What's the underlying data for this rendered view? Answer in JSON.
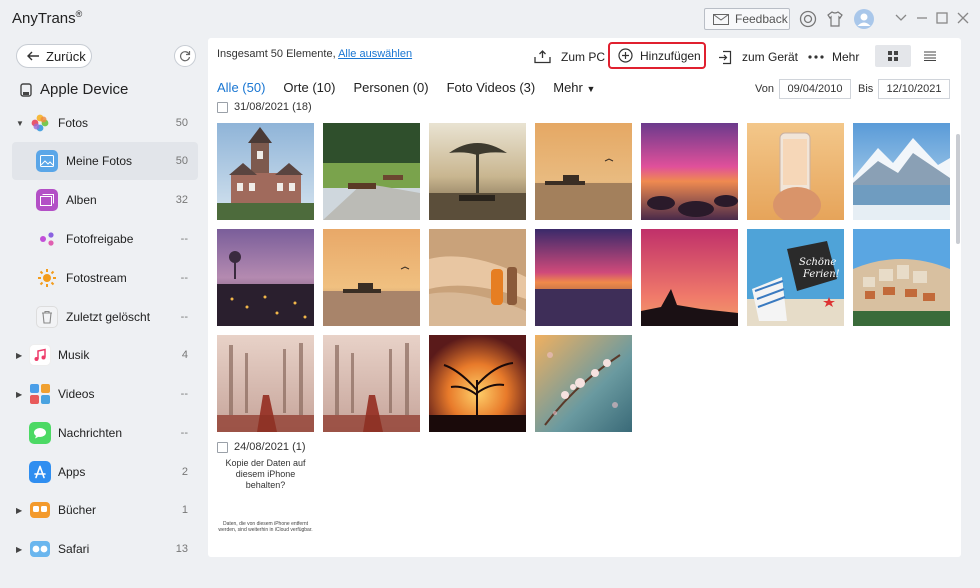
{
  "app": {
    "title": "AnyTrans",
    "trademark": "®"
  },
  "titlebar": {
    "feedback_label": "Feedback"
  },
  "sidebar": {
    "back_label": "Zurück",
    "device_title": "Apple Device",
    "items": [
      {
        "label": "Fotos",
        "count": "50"
      },
      {
        "label": "Meine Fotos",
        "count": "50"
      },
      {
        "label": "Alben",
        "count": "32"
      },
      {
        "label": "Fotofreigabe",
        "count": "--"
      },
      {
        "label": "Fotostream",
        "count": "--"
      },
      {
        "label": "Zuletzt gelöscht",
        "count": "--"
      },
      {
        "label": "Musik",
        "count": "4"
      },
      {
        "label": "Videos",
        "count": "--"
      },
      {
        "label": "Nachrichten",
        "count": "--"
      },
      {
        "label": "Apps",
        "count": "2"
      },
      {
        "label": "Bücher",
        "count": "1"
      },
      {
        "label": "Safari",
        "count": "13"
      }
    ]
  },
  "toolbar": {
    "summary_text": "Insgesamt 50 Elemente,",
    "select_all_label": "Alle auswählen",
    "to_pc_label": "Zum PC",
    "add_label": "Hinzufügen",
    "to_device_label": "zum Gerät",
    "more_label": "Mehr"
  },
  "tabs": [
    {
      "label": "Alle (50)"
    },
    {
      "label": "Orte (10)"
    },
    {
      "label": "Personen (0)"
    },
    {
      "label": "Foto Videos (3)"
    },
    {
      "label": "Mehr"
    }
  ],
  "date_filter": {
    "from_label": "Von",
    "from_value": "09/04/2010",
    "to_label": "Bis",
    "to_value": "12/10/2021"
  },
  "groups": [
    {
      "label": "31/08/2021 (18)"
    },
    {
      "label": "24/08/2021 (1)"
    }
  ],
  "note_thumbnail": {
    "text": "Kopie der Daten auf diesem iPhone behalten?",
    "small_text": "Daten, die von diesem iPhone entfernt werden, sind weiterhin in iCloud verfügbar."
  },
  "photo_thumbnail": {
    "sign_line1": "Schöne",
    "sign_line2": "Ferien!"
  },
  "colors": {
    "accent": "#1976d2",
    "highlight": "#e0202f"
  }
}
